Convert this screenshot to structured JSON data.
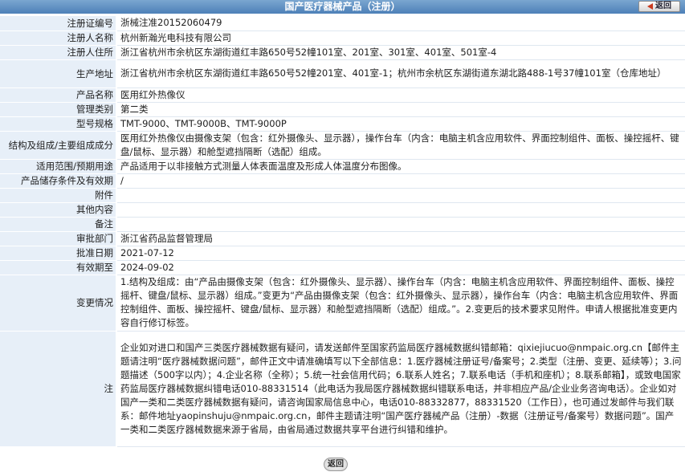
{
  "header": {
    "title": "国产医疗器械产品（注册）",
    "back_label": "返回"
  },
  "rows": [
    {
      "label": "注册证编号",
      "value": "浙械注准20152060479"
    },
    {
      "label": "注册人名称",
      "value": "杭州新瀚光电科技有限公司"
    },
    {
      "label": "注册人住所",
      "value": "浙江省杭州市余杭区东湖街道红丰路650号52幢101室、201室、301室、401室、501室-4"
    },
    {
      "label": "生产地址",
      "value": "浙江省杭州市余杭区东湖街道红丰路650号52幢201室、401室-1；杭州市余杭区东湖街道东湖北路488-1号37幢101室（仓库地址）"
    },
    {
      "label": "产品名称",
      "value": "医用红外热像仪"
    },
    {
      "label": "管理类别",
      "value": "第二类"
    },
    {
      "label": "型号规格",
      "value": "TMT-9000、TMT-9000B、TMT-9000P"
    },
    {
      "label": "结构及组成/主要组成成分",
      "value": "医用红外热像仪由摄像支架（包含：红外摄像头、显示器），操作台车（内含：电脑主机含应用软件、界面控制组件、面板、操控摇杆、键盘/鼠标、显示器）和舱型遮挡隔断（选配）组成。"
    },
    {
      "label": "适用范围/预期用途",
      "value": "产品适用于以非接触方式测量人体表面温度及形成人体温度分布图像。"
    },
    {
      "label": "产品储存条件及有效期",
      "value": "/"
    },
    {
      "label": "附件",
      "value": ""
    },
    {
      "label": "其他内容",
      "value": ""
    },
    {
      "label": "备注",
      "value": ""
    },
    {
      "label": "审批部门",
      "value": "浙江省药品监督管理局"
    },
    {
      "label": "批准日期",
      "value": "2021-07-12"
    },
    {
      "label": "有效期至",
      "value": "2024-09-02"
    },
    {
      "label": "变更情况",
      "value": "1.结构及组成：由“产品由摄像支架（包含：红外摄像头、显示器）、操作台车（内含：电脑主机含应用软件、界面控制组件、面板、操控摇杆、键盘/鼠标、显示器）组成。”变更为“产品由摄像支架（包含：红外摄像头、显示器），操作台车（内含：电脑主机含应用软件、界面控制组件、面板、操控摇杆、键盘/鼠标、显示器）和舱型遮挡隔断（选配）组成。”。2.变更后的技术要求见附件。申请人根据批准变更内容自行修订标签。"
    },
    {
      "label": "注",
      "value": "企业如对进口和国产三类医疗器械数据有疑问，请发送邮件至国家药监局医疗器械数据纠错邮箱：qixiejiucuo@nmpaic.org.cn【邮件主题请注明“医疗器械数据问题”，邮件正文中请准确填写以下全部信息：1.医疗器械注册证号/备案号；2.类型（注册、变更、延续等）；3.问题描述（500字以内）；4.企业名称（全称）；5.统一社会信用代码；6.联系人姓名；7.联系电话（手机和座机）；8.联系邮箱】，或致电国家药监局医疗器械数据纠错电话010-88331514（此电话为我局医疗器械数据纠错联系电话，并非相应产品/企业业务咨询电话）。企业如对国产一类和二类医疗器械数据有疑问，请咨询国家局信息中心，电话010-88332877，88331520（工作日），也可通过发邮件与我们联系：邮件地址yaopinshuju@nmpaic.org.cn，邮件主题请注明“国产医疗器械产品（注册）-数据（注册证号/备案号）数据问题”。国产一类和二类医疗器械数据来源于省局，由省局通过数据共享平台进行纠错和维护。"
    }
  ],
  "footer": {
    "back_label": "返回"
  }
}
